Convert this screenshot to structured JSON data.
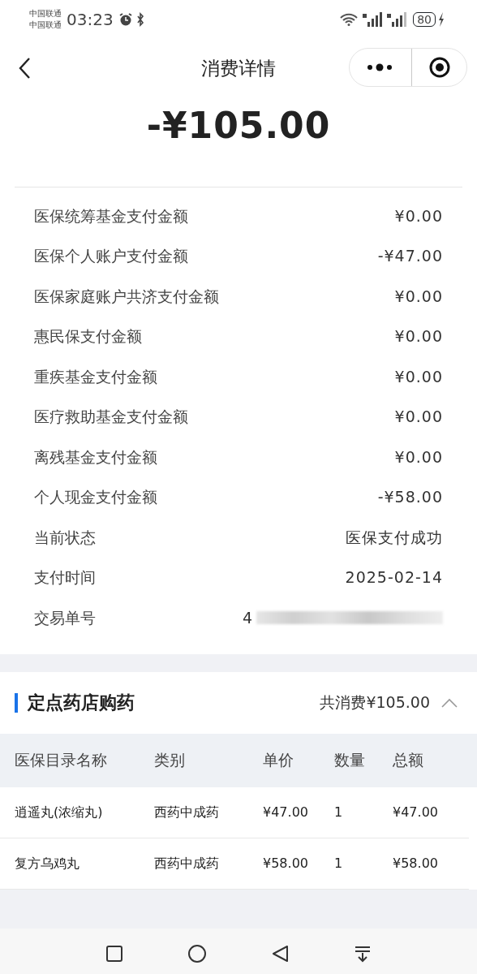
{
  "status_bar": {
    "carriers": [
      "中国联通",
      "中国联通"
    ],
    "time": "03:23",
    "battery": "80"
  },
  "nav": {
    "title": "消费详情"
  },
  "amount": "-¥105.00",
  "details": [
    {
      "label": "医保统筹基金支付金额",
      "value": "¥0.00"
    },
    {
      "label": "医保个人账户支付金额",
      "value": "-¥47.00"
    },
    {
      "label": "医保家庭账户共济支付金额",
      "value": "¥0.00"
    },
    {
      "label": "惠民保支付金额",
      "value": "¥0.00"
    },
    {
      "label": "重疾基金支付金额",
      "value": "¥0.00"
    },
    {
      "label": "医疗救助基金支付金额",
      "value": "¥0.00"
    },
    {
      "label": "离残基金支付金额",
      "value": "¥0.00"
    },
    {
      "label": "个人现金支付金额",
      "value": "-¥58.00"
    },
    {
      "label": "当前状态",
      "value": "医保支付成功"
    },
    {
      "label": "支付时间",
      "value": "2025-02-14"
    },
    {
      "label": "交易单号",
      "value": "4",
      "redacted": true
    }
  ],
  "section": {
    "title": "定点药店购药",
    "total": "共消费¥105.00",
    "expanded": true
  },
  "table": {
    "columns": [
      "医保目录名称",
      "类别",
      "单价",
      "数量",
      "总额"
    ],
    "rows": [
      [
        "逍遥丸(浓缩丸)",
        "西药中成药",
        "¥47.00",
        "1",
        "¥47.00"
      ],
      [
        "复方乌鸡丸",
        "西药中成药",
        "¥58.00",
        "1",
        "¥58.00"
      ]
    ]
  }
}
